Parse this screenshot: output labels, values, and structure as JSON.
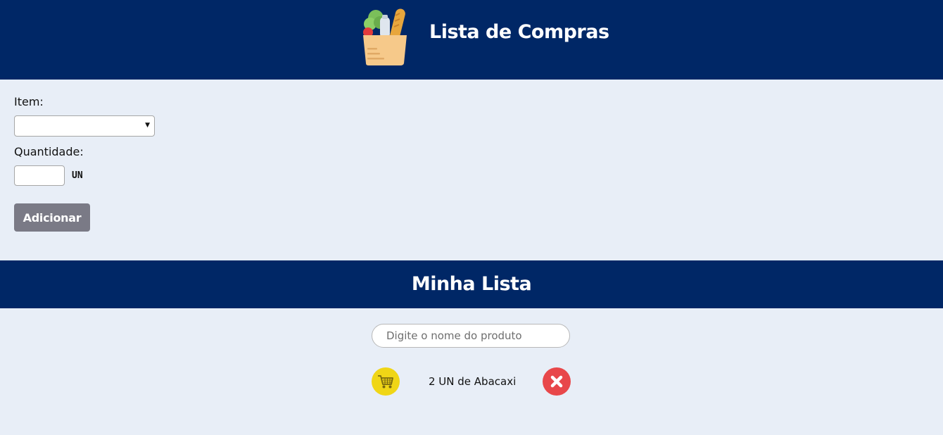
{
  "header": {
    "logo_icon": "grocery-bag-icon",
    "title": "Lista de Compras",
    "background": "#002766"
  },
  "form": {
    "item_label": "Item:",
    "item_select_value": "",
    "quantity_label": "Quantidade:",
    "quantity_value": "",
    "unit_label": "UN",
    "add_button_label": "Adicionar"
  },
  "list": {
    "title": "Minha Lista",
    "search_placeholder": "Digite o nome do produto",
    "items": [
      {
        "text": "2 UN de Abacaxi",
        "cart_icon": "cart-icon",
        "remove_icon": "close-icon",
        "cart_color": "#f0d616",
        "remove_color": "#e8474a"
      }
    ]
  }
}
